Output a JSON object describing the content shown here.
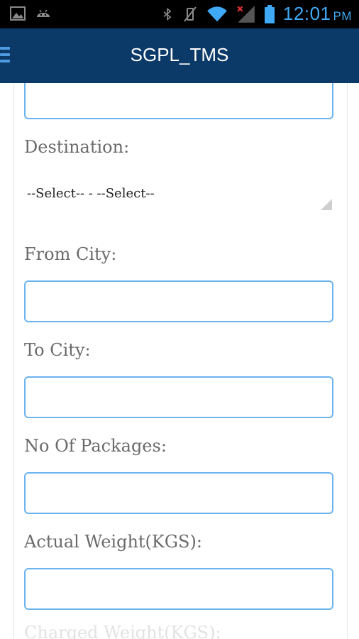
{
  "status_bar": {
    "time": "12:01",
    "ampm": "PM",
    "icons": [
      "image-icon",
      "android-icon",
      "bluetooth-icon",
      "vibrate-icon",
      "wifi-icon",
      "signal-icon",
      "battery-icon"
    ]
  },
  "app_bar": {
    "title": "SGPL_TMS",
    "menu_icon": "menu-icon"
  },
  "colors": {
    "app_bar": "#0c3a68",
    "status_bar": "#000000",
    "accent": "#3fa9f5",
    "input_border": "#6bb4f0",
    "label": "#6a6a6a"
  },
  "form": {
    "destination_label": "Destination:",
    "destination_select": "--Select-- - --Select--",
    "from_city_label": "From City:",
    "from_city_value": "",
    "to_city_label": "To City:",
    "to_city_value": "",
    "packages_label": "No Of Packages:",
    "packages_value": "",
    "actual_weight_label": "Actual Weight(KGS):",
    "actual_weight_value": "",
    "charged_weight_label": "Charged Weight(KGS):"
  }
}
